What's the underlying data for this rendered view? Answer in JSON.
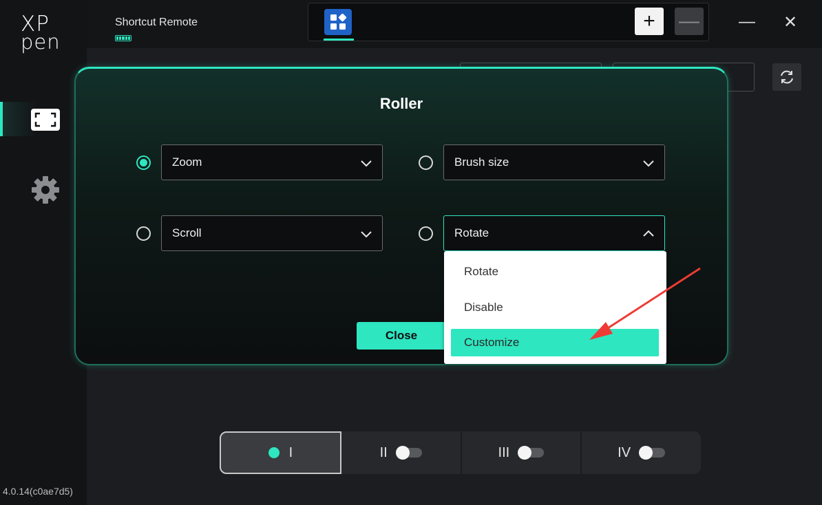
{
  "app": {
    "logo_line1": "XP",
    "logo_line2": "pen",
    "version": "4.0.14(c0ae7d5)"
  },
  "topbar": {
    "device_name": "Shortcut Remote",
    "add_label": "+",
    "remove_label": "—",
    "minimize_label": "—",
    "close_label": "✕"
  },
  "dialog": {
    "title": "Roller",
    "options": [
      {
        "label": "Zoom",
        "selected": true
      },
      {
        "label": "Brush size",
        "selected": false
      },
      {
        "label": "Scroll",
        "selected": false
      },
      {
        "label": "Rotate",
        "selected": false
      }
    ],
    "close_label": "Close",
    "dropdown": {
      "items": [
        "Rotate",
        "Disable",
        "Customize"
      ],
      "highlighted": "Customize"
    }
  },
  "modes": [
    {
      "label": "I",
      "active": true
    },
    {
      "label": "II",
      "active": false
    },
    {
      "label": "III",
      "active": false
    },
    {
      "label": "IV",
      "active": false
    }
  ],
  "colors": {
    "accent": "#2ee6c0",
    "app_tab": "#1f63c7",
    "annotation_arrow": "#ee3b35"
  }
}
